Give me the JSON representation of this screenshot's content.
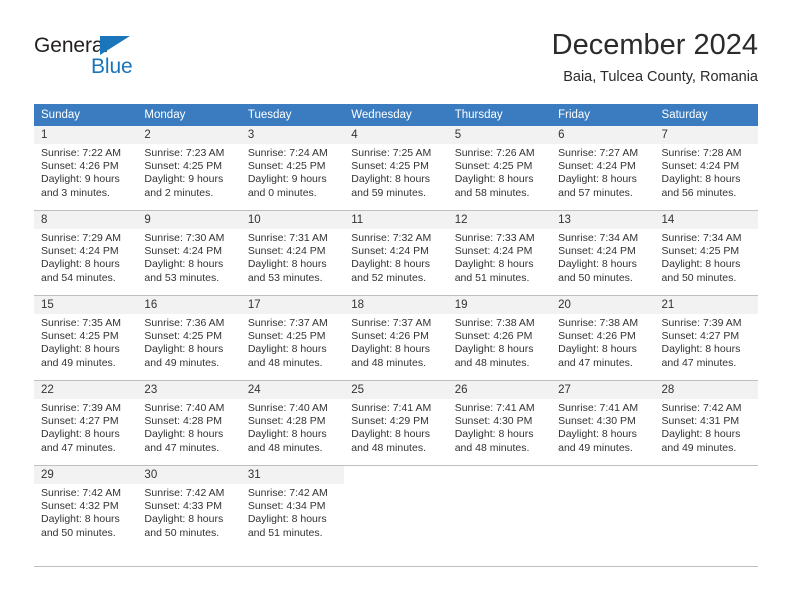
{
  "brand": {
    "name_part1": "General",
    "name_part2": "Blue"
  },
  "header": {
    "title": "December 2024",
    "subtitle": "Baia, Tulcea County, Romania"
  },
  "colors": {
    "header_blue": "#3a7cbf",
    "brand_blue": "#1b75bb",
    "daynum_band": "#f2f2f2",
    "grid_line": "#bfbfbf"
  },
  "weekday_headers": [
    "Sunday",
    "Monday",
    "Tuesday",
    "Wednesday",
    "Thursday",
    "Friday",
    "Saturday"
  ],
  "labels": {
    "sunrise_prefix": "Sunrise:",
    "sunset_prefix": "Sunset:",
    "daylight_prefix": "Daylight:"
  },
  "weeks": [
    [
      {
        "day": "1",
        "sunrise": "Sunrise: 7:22 AM",
        "sunset": "Sunset: 4:26 PM",
        "daylight_line1": "Daylight: 9 hours",
        "daylight_line2": "and 3 minutes."
      },
      {
        "day": "2",
        "sunrise": "Sunrise: 7:23 AM",
        "sunset": "Sunset: 4:25 PM",
        "daylight_line1": "Daylight: 9 hours",
        "daylight_line2": "and 2 minutes."
      },
      {
        "day": "3",
        "sunrise": "Sunrise: 7:24 AM",
        "sunset": "Sunset: 4:25 PM",
        "daylight_line1": "Daylight: 9 hours",
        "daylight_line2": "and 0 minutes."
      },
      {
        "day": "4",
        "sunrise": "Sunrise: 7:25 AM",
        "sunset": "Sunset: 4:25 PM",
        "daylight_line1": "Daylight: 8 hours",
        "daylight_line2": "and 59 minutes."
      },
      {
        "day": "5",
        "sunrise": "Sunrise: 7:26 AM",
        "sunset": "Sunset: 4:25 PM",
        "daylight_line1": "Daylight: 8 hours",
        "daylight_line2": "and 58 minutes."
      },
      {
        "day": "6",
        "sunrise": "Sunrise: 7:27 AM",
        "sunset": "Sunset: 4:24 PM",
        "daylight_line1": "Daylight: 8 hours",
        "daylight_line2": "and 57 minutes."
      },
      {
        "day": "7",
        "sunrise": "Sunrise: 7:28 AM",
        "sunset": "Sunset: 4:24 PM",
        "daylight_line1": "Daylight: 8 hours",
        "daylight_line2": "and 56 minutes."
      }
    ],
    [
      {
        "day": "8",
        "sunrise": "Sunrise: 7:29 AM",
        "sunset": "Sunset: 4:24 PM",
        "daylight_line1": "Daylight: 8 hours",
        "daylight_line2": "and 54 minutes."
      },
      {
        "day": "9",
        "sunrise": "Sunrise: 7:30 AM",
        "sunset": "Sunset: 4:24 PM",
        "daylight_line1": "Daylight: 8 hours",
        "daylight_line2": "and 53 minutes."
      },
      {
        "day": "10",
        "sunrise": "Sunrise: 7:31 AM",
        "sunset": "Sunset: 4:24 PM",
        "daylight_line1": "Daylight: 8 hours",
        "daylight_line2": "and 53 minutes."
      },
      {
        "day": "11",
        "sunrise": "Sunrise: 7:32 AM",
        "sunset": "Sunset: 4:24 PM",
        "daylight_line1": "Daylight: 8 hours",
        "daylight_line2": "and 52 minutes."
      },
      {
        "day": "12",
        "sunrise": "Sunrise: 7:33 AM",
        "sunset": "Sunset: 4:24 PM",
        "daylight_line1": "Daylight: 8 hours",
        "daylight_line2": "and 51 minutes."
      },
      {
        "day": "13",
        "sunrise": "Sunrise: 7:34 AM",
        "sunset": "Sunset: 4:24 PM",
        "daylight_line1": "Daylight: 8 hours",
        "daylight_line2": "and 50 minutes."
      },
      {
        "day": "14",
        "sunrise": "Sunrise: 7:34 AM",
        "sunset": "Sunset: 4:25 PM",
        "daylight_line1": "Daylight: 8 hours",
        "daylight_line2": "and 50 minutes."
      }
    ],
    [
      {
        "day": "15",
        "sunrise": "Sunrise: 7:35 AM",
        "sunset": "Sunset: 4:25 PM",
        "daylight_line1": "Daylight: 8 hours",
        "daylight_line2": "and 49 minutes."
      },
      {
        "day": "16",
        "sunrise": "Sunrise: 7:36 AM",
        "sunset": "Sunset: 4:25 PM",
        "daylight_line1": "Daylight: 8 hours",
        "daylight_line2": "and 49 minutes."
      },
      {
        "day": "17",
        "sunrise": "Sunrise: 7:37 AM",
        "sunset": "Sunset: 4:25 PM",
        "daylight_line1": "Daylight: 8 hours",
        "daylight_line2": "and 48 minutes."
      },
      {
        "day": "18",
        "sunrise": "Sunrise: 7:37 AM",
        "sunset": "Sunset: 4:26 PM",
        "daylight_line1": "Daylight: 8 hours",
        "daylight_line2": "and 48 minutes."
      },
      {
        "day": "19",
        "sunrise": "Sunrise: 7:38 AM",
        "sunset": "Sunset: 4:26 PM",
        "daylight_line1": "Daylight: 8 hours",
        "daylight_line2": "and 48 minutes."
      },
      {
        "day": "20",
        "sunrise": "Sunrise: 7:38 AM",
        "sunset": "Sunset: 4:26 PM",
        "daylight_line1": "Daylight: 8 hours",
        "daylight_line2": "and 47 minutes."
      },
      {
        "day": "21",
        "sunrise": "Sunrise: 7:39 AM",
        "sunset": "Sunset: 4:27 PM",
        "daylight_line1": "Daylight: 8 hours",
        "daylight_line2": "and 47 minutes."
      }
    ],
    [
      {
        "day": "22",
        "sunrise": "Sunrise: 7:39 AM",
        "sunset": "Sunset: 4:27 PM",
        "daylight_line1": "Daylight: 8 hours",
        "daylight_line2": "and 47 minutes."
      },
      {
        "day": "23",
        "sunrise": "Sunrise: 7:40 AM",
        "sunset": "Sunset: 4:28 PM",
        "daylight_line1": "Daylight: 8 hours",
        "daylight_line2": "and 47 minutes."
      },
      {
        "day": "24",
        "sunrise": "Sunrise: 7:40 AM",
        "sunset": "Sunset: 4:28 PM",
        "daylight_line1": "Daylight: 8 hours",
        "daylight_line2": "and 48 minutes."
      },
      {
        "day": "25",
        "sunrise": "Sunrise: 7:41 AM",
        "sunset": "Sunset: 4:29 PM",
        "daylight_line1": "Daylight: 8 hours",
        "daylight_line2": "and 48 minutes."
      },
      {
        "day": "26",
        "sunrise": "Sunrise: 7:41 AM",
        "sunset": "Sunset: 4:30 PM",
        "daylight_line1": "Daylight: 8 hours",
        "daylight_line2": "and 48 minutes."
      },
      {
        "day": "27",
        "sunrise": "Sunrise: 7:41 AM",
        "sunset": "Sunset: 4:30 PM",
        "daylight_line1": "Daylight: 8 hours",
        "daylight_line2": "and 49 minutes."
      },
      {
        "day": "28",
        "sunrise": "Sunrise: 7:42 AM",
        "sunset": "Sunset: 4:31 PM",
        "daylight_line1": "Daylight: 8 hours",
        "daylight_line2": "and 49 minutes."
      }
    ],
    [
      {
        "day": "29",
        "sunrise": "Sunrise: 7:42 AM",
        "sunset": "Sunset: 4:32 PM",
        "daylight_line1": "Daylight: 8 hours",
        "daylight_line2": "and 50 minutes."
      },
      {
        "day": "30",
        "sunrise": "Sunrise: 7:42 AM",
        "sunset": "Sunset: 4:33 PM",
        "daylight_line1": "Daylight: 8 hours",
        "daylight_line2": "and 50 minutes."
      },
      {
        "day": "31",
        "sunrise": "Sunrise: 7:42 AM",
        "sunset": "Sunset: 4:34 PM",
        "daylight_line1": "Daylight: 8 hours",
        "daylight_line2": "and 51 minutes."
      },
      {
        "day": "",
        "sunrise": "",
        "sunset": "",
        "daylight_line1": "",
        "daylight_line2": ""
      },
      {
        "day": "",
        "sunrise": "",
        "sunset": "",
        "daylight_line1": "",
        "daylight_line2": ""
      },
      {
        "day": "",
        "sunrise": "",
        "sunset": "",
        "daylight_line1": "",
        "daylight_line2": ""
      },
      {
        "day": "",
        "sunrise": "",
        "sunset": "",
        "daylight_line1": "",
        "daylight_line2": ""
      }
    ]
  ]
}
